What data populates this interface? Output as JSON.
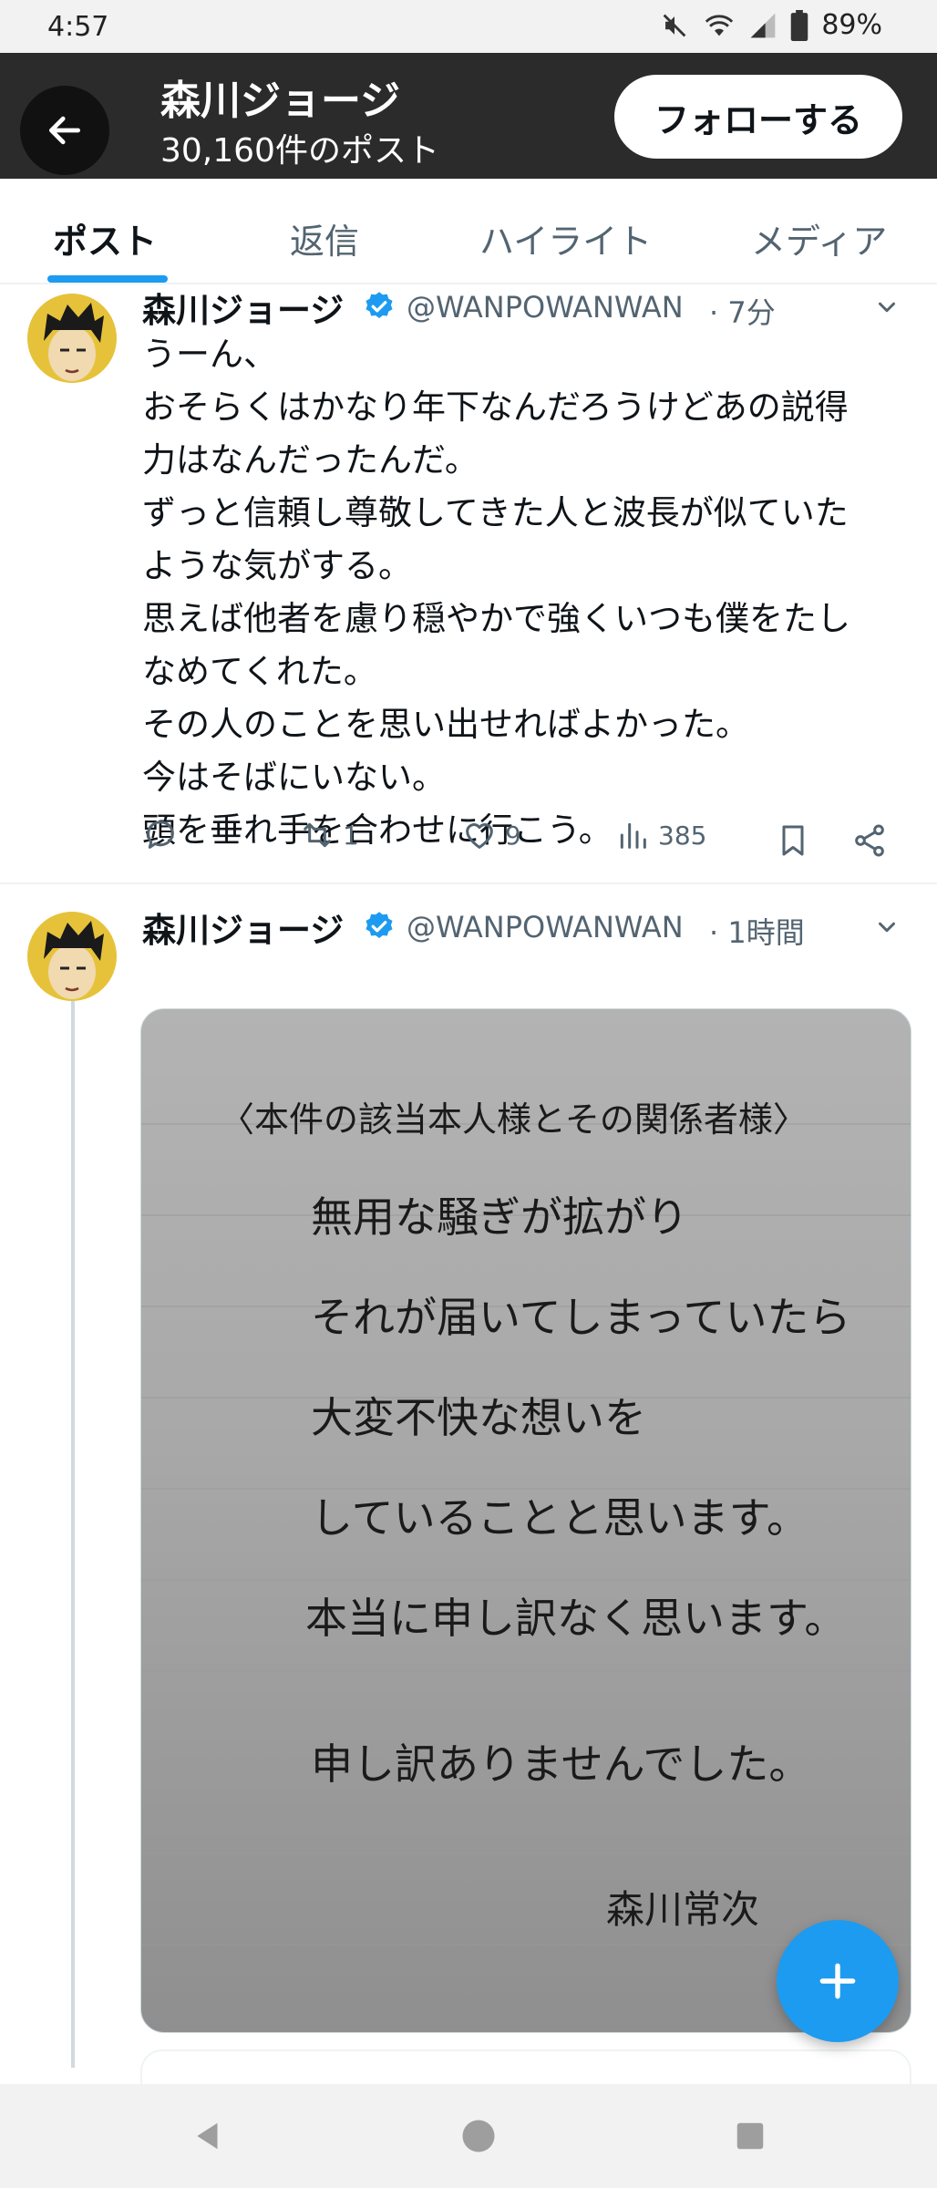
{
  "status_bar": {
    "time": "4:57",
    "battery": "89%",
    "icons": [
      "mute-icon",
      "wifi-icon",
      "signal-icon",
      "battery-icon"
    ]
  },
  "profile_header": {
    "name": "森川ジョージ",
    "post_count": "30,160件のポスト",
    "follow_button": "フォローする",
    "back_icon": "arrow-left-icon"
  },
  "tabs": [
    {
      "label": "ポスト",
      "active": true
    },
    {
      "label": "返信",
      "active": false
    },
    {
      "label": "ハイライト",
      "active": false
    },
    {
      "label": "メディア",
      "active": false
    }
  ],
  "tweets": [
    {
      "name": "森川ジョージ",
      "handle": "@WANPOWANWAN",
      "time": "· 7分",
      "text": "うーん、\nおそらくはかなり年下なんだろうけどあの説得\n力はなんだったんだ。\nずっと信頼し尊敬してきた人と波長が似ていた\nような気がする。\n思えば他者を慮り穏やかで強くいつも僕をたし\nなめてくれた。\nその人のことを思い出せればよかった。\n今はそばにいない。\n頭を垂れ手を合わせに行こう。",
      "actions": {
        "replies": "",
        "reposts": "1",
        "likes": "9",
        "views": "385"
      }
    },
    {
      "name": "森川ジョージ",
      "handle": "@WANPOWANWAN",
      "time": "· 1時間",
      "image_lines": [
        "〈本件の該当本人様とその関係者様〉",
        "無用な騒ぎが拡がり",
        "それが届いてしまっていたら",
        "大変不快な想いを",
        "していることと思います。",
        "本当に申し訳なく思います。",
        "申し訳ありませんでした。",
        "森川常次"
      ]
    }
  ],
  "fab_icon": "plus-icon",
  "nav_bar": [
    "back-triangle-icon",
    "home-circle-icon",
    "recents-square-icon"
  ],
  "colors": {
    "accent": "#1d9bf0",
    "header_bg": "#2b2b2b",
    "muted_text": "#536471"
  }
}
